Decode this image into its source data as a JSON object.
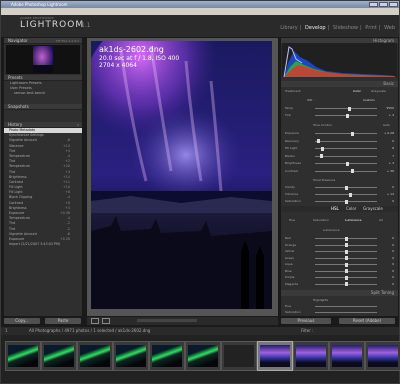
{
  "window": {
    "title": "Adobe Photoshop Lightroom"
  },
  "menu": [
    "File",
    "Edit",
    "Develop",
    "Photo",
    "Settings",
    "View",
    "Window",
    "Help"
  ],
  "identity": {
    "small": "ADOBE PHOTOSHOP",
    "name": "LIGHTROOM",
    "version": "1.1"
  },
  "modules": [
    "Library",
    "Develop",
    "Slideshow",
    "Print",
    "Web"
  ],
  "modules_sep": "|",
  "left": {
    "navigator": {
      "label": "Navigator",
      "zoom": "FIT  FILL  1:1  3:1"
    },
    "presets": {
      "label": "Presets",
      "items": [
        "Lightroom Presets",
        "User Presets",
        "sensor-test-bench"
      ]
    },
    "snapshots": {
      "label": "Snapshots"
    },
    "history": {
      "label": "History",
      "clear": "X",
      "items": [
        {
          "label": "Photo Metadata",
          "value": "",
          "sel": true
        },
        {
          "label": "Synchronize Settings",
          "value": ""
        },
        {
          "label": "Vignette Amount",
          "value": "-6"
        },
        {
          "label": "Vibrance",
          "value": "+14"
        },
        {
          "label": "Tint",
          "value": "+4"
        },
        {
          "label": "Temperature",
          "value": "-4"
        },
        {
          "label": "Tint",
          "value": "+2"
        },
        {
          "label": "Temperature",
          "value": "+20"
        },
        {
          "label": "Tint",
          "value": "+4"
        },
        {
          "label": "Brightness",
          "value": "+14"
        },
        {
          "label": "Contrast",
          "value": "+11"
        },
        {
          "label": "Fill Light",
          "value": "+10"
        },
        {
          "label": "Fill Light",
          "value": "+8"
        },
        {
          "label": "Black Clipping",
          "value": "-4"
        },
        {
          "label": "Contrast",
          "value": "+8"
        },
        {
          "label": "Brightness",
          "value": "+3"
        },
        {
          "label": "Exposure",
          "value": "+0.36"
        },
        {
          "label": "Temperature",
          "value": "-4"
        },
        {
          "label": "Tint",
          "value": "-2"
        },
        {
          "label": "Tint",
          "value": "-2"
        },
        {
          "label": "Vignette Amount",
          "value": "-6"
        },
        {
          "label": "Exposure",
          "value": "+0.28"
        },
        {
          "label": "Import (2/21/2007 3:43:03 PM)",
          "value": ""
        }
      ]
    },
    "copy_label": "Copy...",
    "paste_label": "Paste"
  },
  "photo": {
    "filename": "ak1ds-2602.dng",
    "exposure": "20.0 sec at f / 1.8, ISO 400",
    "dims": "2704 x 4064"
  },
  "right": {
    "histogram": {
      "label": "Histogram"
    },
    "basic": {
      "label": "Basic",
      "treatment_label": "Treatment:",
      "treatment": [
        "Color",
        "Grayscale"
      ],
      "wb_label": "WB :",
      "wb": "Custom",
      "sliders": [
        {
          "label": "Temp",
          "value": "5550",
          "pos": 0.55
        },
        {
          "label": "Tint",
          "value": "+ 4",
          "pos": 0.52
        }
      ],
      "tone_label": "Tone Control",
      "auto": "Auto",
      "tone": [
        {
          "label": "Exposure",
          "value": "+ 0.28",
          "pos": 0.6
        },
        {
          "label": "Recovery",
          "value": "0",
          "pos": 0.05
        },
        {
          "label": "Fill Light",
          "value": "8",
          "pos": 0.12
        },
        {
          "label": "Blacks",
          "value": "7",
          "pos": 0.1
        },
        {
          "label": "Brightness",
          "value": "+ 3",
          "pos": 0.52
        },
        {
          "label": "Contrast",
          "value": "+ 36",
          "pos": 0.6
        }
      ],
      "presence_label": "Tonal Presence",
      "presence": [
        {
          "label": "Clarity",
          "value": "0",
          "pos": 0.5
        },
        {
          "label": "Vibrance",
          "value": "+ 14",
          "pos": 0.58
        },
        {
          "label": "Saturation",
          "value": "0",
          "pos": 0.5
        }
      ]
    },
    "hsl": {
      "tabs": [
        "HSL",
        "Color",
        "Grayscale"
      ],
      "sub": [
        "Hue",
        "Saturation",
        "Luminance",
        "All"
      ],
      "lum_label": "Luminance",
      "rows": [
        {
          "label": "Red",
          "value": "0",
          "pos": 0.5
        },
        {
          "label": "Orange",
          "value": "0",
          "pos": 0.5
        },
        {
          "label": "Yellow",
          "value": "0",
          "pos": 0.5
        },
        {
          "label": "Green",
          "value": "0",
          "pos": 0.5
        },
        {
          "label": "Aqua",
          "value": "0",
          "pos": 0.5
        },
        {
          "label": "Blue",
          "value": "0",
          "pos": 0.5
        },
        {
          "label": "Purple",
          "value": "0",
          "pos": 0.5
        },
        {
          "label": "Magenta",
          "value": "0",
          "pos": 0.5
        }
      ]
    },
    "split": {
      "label": "Split Toning",
      "highlights": "Highlights",
      "hue_label": "Hue",
      "sat_label": "Saturation"
    },
    "prev_label": "Previous",
    "reset_label": "Reset (Adobe)"
  },
  "filmbar": {
    "page": "1",
    "path": "All Photographs / 4971 photos / 1 selected / ak1ds-2602.dng",
    "filter": "Filter :"
  },
  "filmstrip": {
    "count": 11,
    "selected_index": 7
  }
}
